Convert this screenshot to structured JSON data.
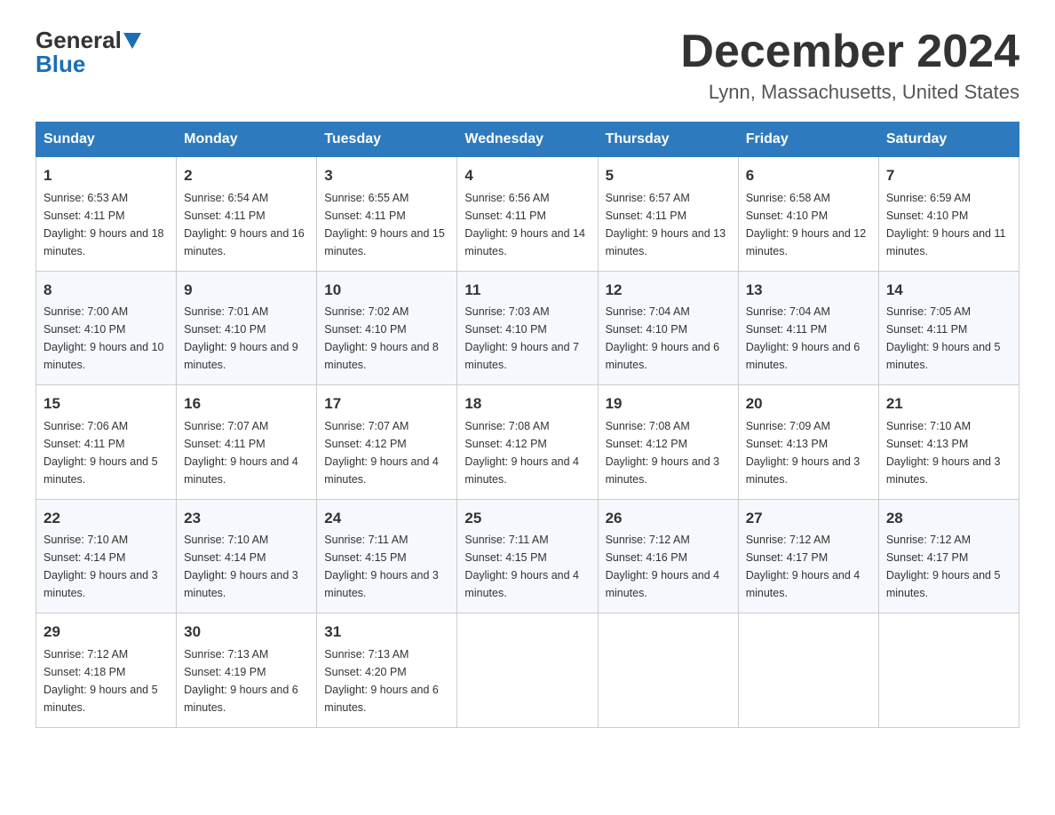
{
  "header": {
    "logo_general": "General",
    "logo_blue": "Blue",
    "month_title": "December 2024",
    "location": "Lynn, Massachusetts, United States"
  },
  "days_of_week": [
    "Sunday",
    "Monday",
    "Tuesday",
    "Wednesday",
    "Thursday",
    "Friday",
    "Saturday"
  ],
  "weeks": [
    [
      {
        "num": "1",
        "sunrise": "6:53 AM",
        "sunset": "4:11 PM",
        "daylight": "9 hours and 18 minutes."
      },
      {
        "num": "2",
        "sunrise": "6:54 AM",
        "sunset": "4:11 PM",
        "daylight": "9 hours and 16 minutes."
      },
      {
        "num": "3",
        "sunrise": "6:55 AM",
        "sunset": "4:11 PM",
        "daylight": "9 hours and 15 minutes."
      },
      {
        "num": "4",
        "sunrise": "6:56 AM",
        "sunset": "4:11 PM",
        "daylight": "9 hours and 14 minutes."
      },
      {
        "num": "5",
        "sunrise": "6:57 AM",
        "sunset": "4:11 PM",
        "daylight": "9 hours and 13 minutes."
      },
      {
        "num": "6",
        "sunrise": "6:58 AM",
        "sunset": "4:10 PM",
        "daylight": "9 hours and 12 minutes."
      },
      {
        "num": "7",
        "sunrise": "6:59 AM",
        "sunset": "4:10 PM",
        "daylight": "9 hours and 11 minutes."
      }
    ],
    [
      {
        "num": "8",
        "sunrise": "7:00 AM",
        "sunset": "4:10 PM",
        "daylight": "9 hours and 10 minutes."
      },
      {
        "num": "9",
        "sunrise": "7:01 AM",
        "sunset": "4:10 PM",
        "daylight": "9 hours and 9 minutes."
      },
      {
        "num": "10",
        "sunrise": "7:02 AM",
        "sunset": "4:10 PM",
        "daylight": "9 hours and 8 minutes."
      },
      {
        "num": "11",
        "sunrise": "7:03 AM",
        "sunset": "4:10 PM",
        "daylight": "9 hours and 7 minutes."
      },
      {
        "num": "12",
        "sunrise": "7:04 AM",
        "sunset": "4:10 PM",
        "daylight": "9 hours and 6 minutes."
      },
      {
        "num": "13",
        "sunrise": "7:04 AM",
        "sunset": "4:11 PM",
        "daylight": "9 hours and 6 minutes."
      },
      {
        "num": "14",
        "sunrise": "7:05 AM",
        "sunset": "4:11 PM",
        "daylight": "9 hours and 5 minutes."
      }
    ],
    [
      {
        "num": "15",
        "sunrise": "7:06 AM",
        "sunset": "4:11 PM",
        "daylight": "9 hours and 5 minutes."
      },
      {
        "num": "16",
        "sunrise": "7:07 AM",
        "sunset": "4:11 PM",
        "daylight": "9 hours and 4 minutes."
      },
      {
        "num": "17",
        "sunrise": "7:07 AM",
        "sunset": "4:12 PM",
        "daylight": "9 hours and 4 minutes."
      },
      {
        "num": "18",
        "sunrise": "7:08 AM",
        "sunset": "4:12 PM",
        "daylight": "9 hours and 4 minutes."
      },
      {
        "num": "19",
        "sunrise": "7:08 AM",
        "sunset": "4:12 PM",
        "daylight": "9 hours and 3 minutes."
      },
      {
        "num": "20",
        "sunrise": "7:09 AM",
        "sunset": "4:13 PM",
        "daylight": "9 hours and 3 minutes."
      },
      {
        "num": "21",
        "sunrise": "7:10 AM",
        "sunset": "4:13 PM",
        "daylight": "9 hours and 3 minutes."
      }
    ],
    [
      {
        "num": "22",
        "sunrise": "7:10 AM",
        "sunset": "4:14 PM",
        "daylight": "9 hours and 3 minutes."
      },
      {
        "num": "23",
        "sunrise": "7:10 AM",
        "sunset": "4:14 PM",
        "daylight": "9 hours and 3 minutes."
      },
      {
        "num": "24",
        "sunrise": "7:11 AM",
        "sunset": "4:15 PM",
        "daylight": "9 hours and 3 minutes."
      },
      {
        "num": "25",
        "sunrise": "7:11 AM",
        "sunset": "4:15 PM",
        "daylight": "9 hours and 4 minutes."
      },
      {
        "num": "26",
        "sunrise": "7:12 AM",
        "sunset": "4:16 PM",
        "daylight": "9 hours and 4 minutes."
      },
      {
        "num": "27",
        "sunrise": "7:12 AM",
        "sunset": "4:17 PM",
        "daylight": "9 hours and 4 minutes."
      },
      {
        "num": "28",
        "sunrise": "7:12 AM",
        "sunset": "4:17 PM",
        "daylight": "9 hours and 5 minutes."
      }
    ],
    [
      {
        "num": "29",
        "sunrise": "7:12 AM",
        "sunset": "4:18 PM",
        "daylight": "9 hours and 5 minutes."
      },
      {
        "num": "30",
        "sunrise": "7:13 AM",
        "sunset": "4:19 PM",
        "daylight": "9 hours and 6 minutes."
      },
      {
        "num": "31",
        "sunrise": "7:13 AM",
        "sunset": "4:20 PM",
        "daylight": "9 hours and 6 minutes."
      },
      null,
      null,
      null,
      null
    ]
  ]
}
